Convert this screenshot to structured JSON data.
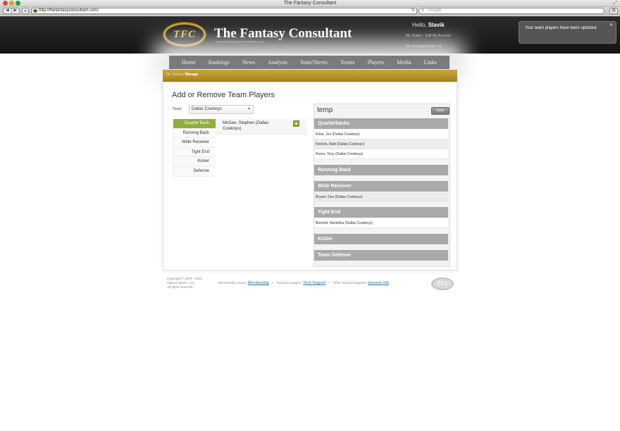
{
  "browser": {
    "window_title": "The Fantasy Consultant",
    "url": "http://thefantasyconsultant.com/",
    "search_placeholder": "Google"
  },
  "header": {
    "logo_text": "TFC",
    "site_title": "The Fantasy Consultant",
    "site_url": "www.thefantasyconsultant.com",
    "greeting": "Hello,",
    "username": "Slavik",
    "links": [
      "My Teams",
      "Edit My Account"
    ],
    "links2": [
      "My messages",
      "Sign out"
    ]
  },
  "notification": {
    "message": "Your team players have been updated."
  },
  "nav": [
    "Home",
    "Rankings",
    "News",
    "Analysis",
    "Stats/Sheets",
    "Teams",
    "Players",
    "Media",
    "Links"
  ],
  "breadcrumb": {
    "parent": "My Teams",
    "separator": "/",
    "current": "Manage"
  },
  "main": {
    "title": "Add or Remove Team Players",
    "team_label": "Team:",
    "team_value": "Dallas Cowboys",
    "positions": [
      "Quarter Back",
      "Running Back",
      "Wide Receiver",
      "Tight End",
      "Kicker",
      "Defense"
    ],
    "available_player": "McGee, Stephen (Dallas Cowboys)",
    "add_label": "+"
  },
  "roster": {
    "name": "temp",
    "save_label": "Save",
    "sections": [
      {
        "title": "Quarterbacks",
        "players": [
          "Kitna, Jon (Dallas Cowboys)",
          "Nichols, Matt (Dallas Cowboys)",
          "Romo, Tony (Dallas Cowboys)"
        ]
      },
      {
        "title": "Running Back",
        "players": []
      },
      {
        "title": "Wide Receiver",
        "players": [
          "Bryant, Dez (Dallas Cowboys)"
        ]
      },
      {
        "title": "Tight End",
        "players": [
          "Bennett, Martellus (Dallas Cowboys)"
        ]
      },
      {
        "title": "Kicker",
        "players": []
      },
      {
        "title": "Team Defense",
        "players": []
      }
    ]
  },
  "footer": {
    "copyright": [
      "Copyright © 2009—2010",
      "Zagura Sports, LLC",
      "All rights reserved."
    ],
    "membership_prefix": "Membership Issues:",
    "membership_link": "Membership",
    "support_prefix": "Technical Support:",
    "support_link": "Tech Support",
    "general_prefix": "Other General Inquiries:",
    "general_link": "General Info",
    "logo_text": "TFC"
  }
}
